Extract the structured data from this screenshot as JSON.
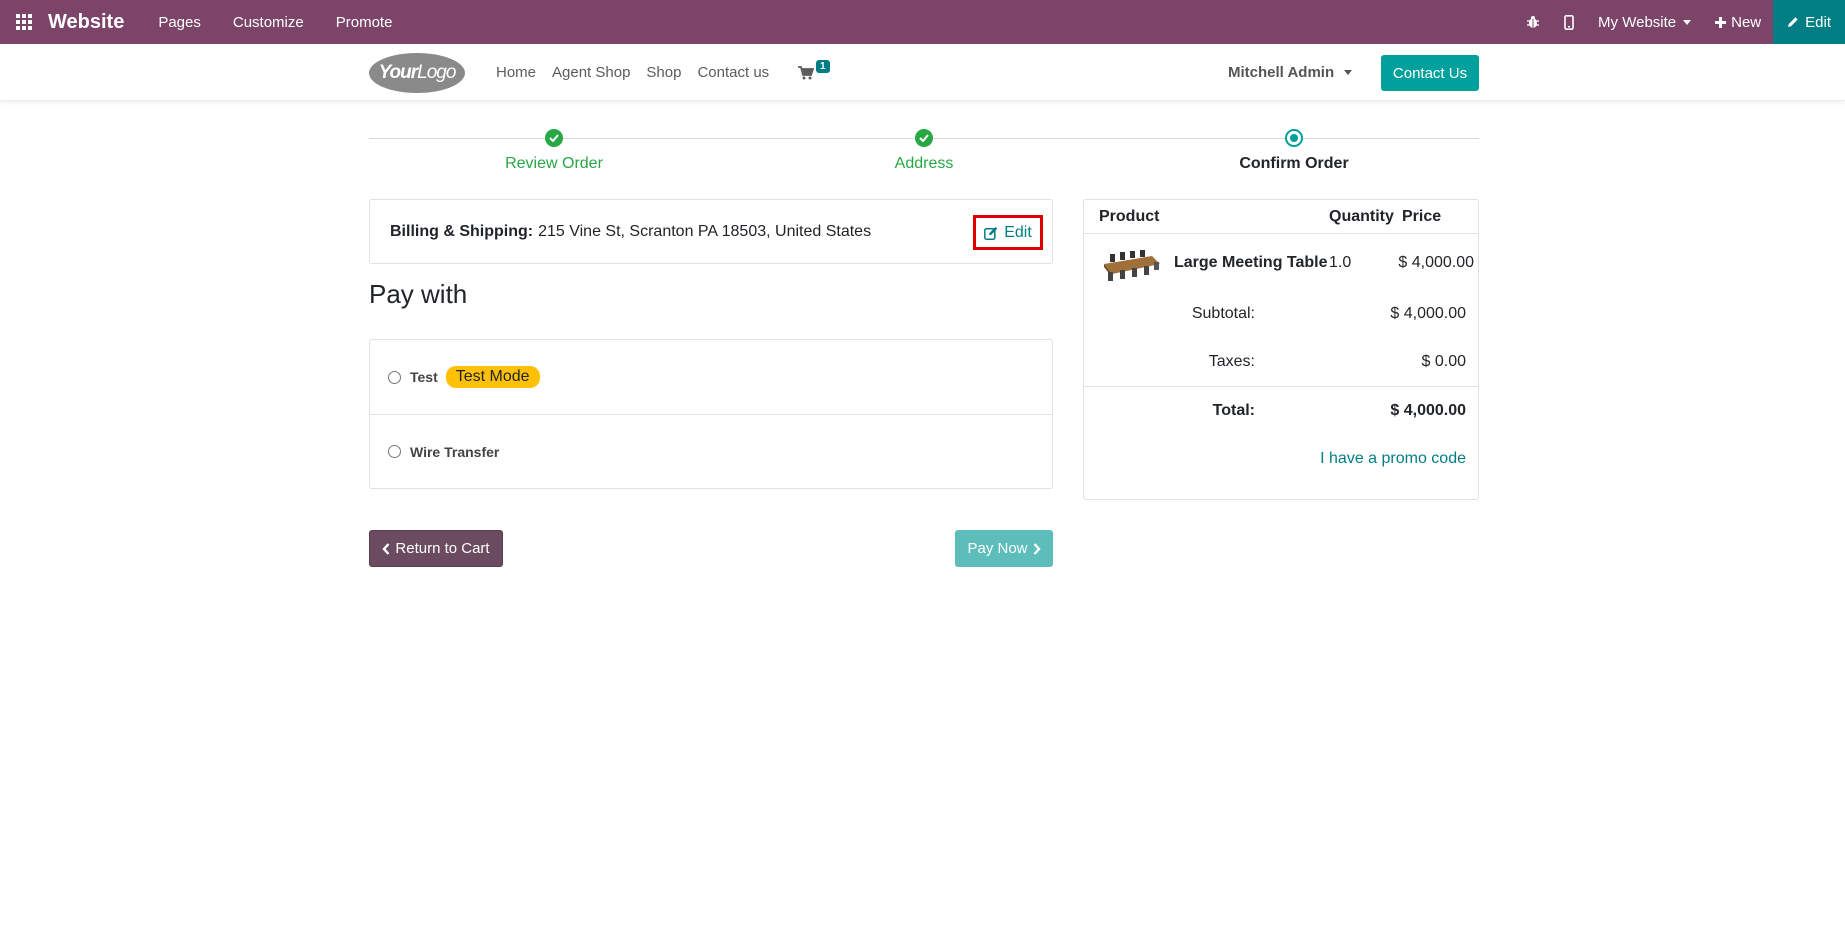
{
  "adminbar": {
    "brand": "Website",
    "menus": [
      "Pages",
      "Customize",
      "Promote"
    ],
    "website_selector": "My Website",
    "new_label": "New",
    "edit_label": "Edit"
  },
  "header": {
    "logo_part1": "Your",
    "logo_part2": "Logo",
    "nav": [
      "Home",
      "Agent Shop",
      "Shop",
      "Contact us"
    ],
    "cart_count": "1",
    "user_name": "Mitchell Admin",
    "contact_button": "Contact Us"
  },
  "steps": [
    {
      "label": "Review Order",
      "state": "done"
    },
    {
      "label": "Address",
      "state": "done"
    },
    {
      "label": "Confirm Order",
      "state": "current"
    }
  ],
  "billing": {
    "label": "Billing & Shipping:",
    "address": "215 Vine St, Scranton PA 18503, United States",
    "edit_label": "Edit"
  },
  "payment": {
    "title": "Pay with",
    "options": [
      {
        "label": "Test",
        "badge": "Test Mode"
      },
      {
        "label": "Wire Transfer"
      }
    ],
    "return_label": "Return to Cart",
    "pay_label": "Pay Now"
  },
  "summary": {
    "headers": {
      "product": "Product",
      "quantity": "Quantity",
      "price": "Price"
    },
    "item": {
      "name": "Large Meeting Table",
      "quantity": "1.0",
      "price": "$ 4,000.00"
    },
    "subtotal_label": "Subtotal:",
    "subtotal": "$ 4,000.00",
    "taxes_label": "Taxes:",
    "taxes": "$ 0.00",
    "total_label": "Total:",
    "total": "$ 4,000.00",
    "promo_label": "I have a promo code"
  },
  "colors": {
    "admin_bar": "#7c4469",
    "primary": "#017e84",
    "success": "#28a745",
    "badge_warning": "#ffc107",
    "highlight": "#e00000"
  }
}
